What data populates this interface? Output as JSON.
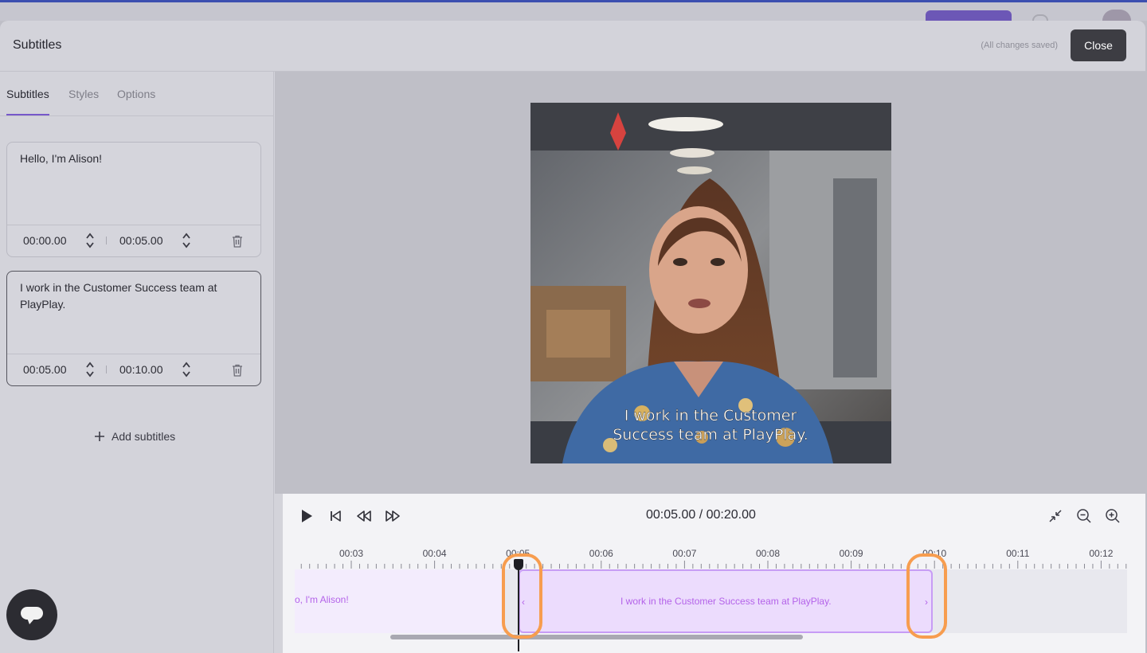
{
  "modal": {
    "title": "Subtitles",
    "saved_status": "(All changes saved)",
    "close_label": "Close"
  },
  "tabs": [
    {
      "label": "Subtitles",
      "active": true
    },
    {
      "label": "Styles",
      "active": false
    },
    {
      "label": "Options",
      "active": false
    }
  ],
  "subtitles": [
    {
      "text": "Hello, I'm Alison!",
      "start": "00:00.00",
      "end": "00:05.00",
      "selected": false
    },
    {
      "text": "I work in the Customer Success team at PlayPlay.",
      "start": "00:05.00",
      "end": "00:10.00",
      "selected": true
    }
  ],
  "add_subtitles_label": "Add subtitles",
  "video": {
    "caption_line1": "I work in the Customer",
    "caption_line2": "Success team at PlayPlay."
  },
  "player": {
    "time_display": "00:05.00 / 00:20.00",
    "current_time_s": 5,
    "duration_s": 20
  },
  "timeline": {
    "tick_labels": [
      "00:03",
      "00:04",
      "00:05",
      "00:06",
      "00:07",
      "00:08",
      "00:09",
      "00:10",
      "00:11",
      "00:12"
    ],
    "clip1_label": "o, I'm Alison!",
    "clip2_label": "I work in the Customer Success team at PlayPlay."
  },
  "colors": {
    "accent_purple": "#7658c9",
    "clip_text": "#b463e9",
    "highlight_orange": "#f79d4f",
    "close_button": "#3d3d43"
  },
  "icons": [
    "play-icon",
    "skip-back-icon",
    "rewind-icon",
    "fast-forward-icon",
    "collapse-icon",
    "zoom-out-icon",
    "zoom-in-icon",
    "trash-icon",
    "plus-icon",
    "chat-icon"
  ]
}
